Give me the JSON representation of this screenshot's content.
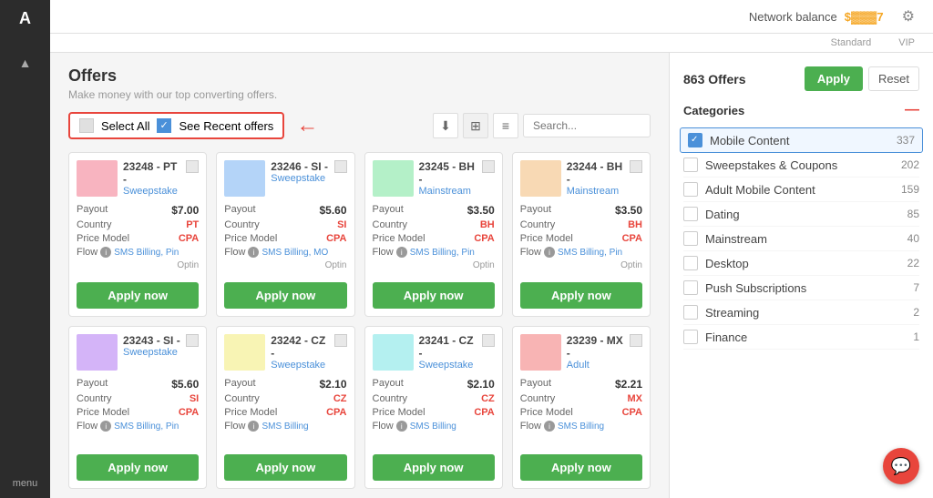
{
  "sidebar": {
    "logo": "A",
    "arrow": "▲",
    "menu_label": "menu"
  },
  "header": {
    "network_balance_label": "Network balance",
    "balance_amount": "$▓▓▓7",
    "standard_label": "Standard",
    "vip_label": "VIP",
    "gear_icon": "⚙"
  },
  "toolbar": {
    "select_all_label": "Select All",
    "see_recent_label": "See Recent offers",
    "search_placeholder": "Search...",
    "download_icon": "⬇",
    "grid_icon": "⊞",
    "list_icon": "≡"
  },
  "page": {
    "title": "Offers",
    "subtitle": "Make money with our top converting offers."
  },
  "filter_panel": {
    "offers_count": "863 Offers",
    "apply_btn": "Apply",
    "reset_btn": "Reset",
    "categories_title": "Categories",
    "categories": [
      {
        "name": "Mobile Content",
        "count": 337,
        "checked": true
      },
      {
        "name": "Sweepstakes & Coupons",
        "count": 202,
        "checked": false
      },
      {
        "name": "Adult Mobile Content",
        "count": 159,
        "checked": false
      },
      {
        "name": "Dating",
        "count": 85,
        "checked": false
      },
      {
        "name": "Mainstream",
        "count": 40,
        "checked": false
      },
      {
        "name": "Desktop",
        "count": 22,
        "checked": false
      },
      {
        "name": "Push Subscriptions",
        "count": 7,
        "checked": false
      },
      {
        "name": "Streaming",
        "count": 2,
        "checked": false
      },
      {
        "name": "Finance",
        "count": 1,
        "checked": false
      }
    ]
  },
  "offers": [
    {
      "id": "23248 - PT -",
      "type": "Sweepstake",
      "payout": "$7.00",
      "country": "PT",
      "price_model": "CPA",
      "flow": "SMS Billing, Pin",
      "optin": "Optin",
      "thumb_color": "pink"
    },
    {
      "id": "23246 - SI -",
      "type": "Sweepstake",
      "payout": "$5.60",
      "country": "SI",
      "price_model": "CPA",
      "flow": "SMS Billing, MO",
      "optin": "Optin",
      "thumb_color": "blue"
    },
    {
      "id": "23245 - BH -",
      "type": "Mainstream",
      "payout": "$3.50",
      "country": "BH",
      "price_model": "CPA",
      "flow": "SMS Billing, Pin",
      "optin": "Optin",
      "thumb_color": "green"
    },
    {
      "id": "23244 - BH -",
      "type": "Mainstream",
      "payout": "$3.50",
      "country": "BH",
      "price_model": "CPA",
      "flow": "SMS Billing, Pin",
      "optin": "Optin",
      "thumb_color": "orange"
    },
    {
      "id": "23243 - SI -",
      "type": "Sweepstake",
      "payout": "$5.60",
      "country": "SI",
      "price_model": "CPA",
      "flow": "SMS Billing, Pin",
      "optin": "",
      "thumb_color": "purple"
    },
    {
      "id": "23242 - CZ -",
      "type": "Sweepstake",
      "payout": "$2.10",
      "country": "CZ",
      "price_model": "CPA",
      "flow": "SMS Billing",
      "optin": "",
      "thumb_color": "yellow"
    },
    {
      "id": "23241 - CZ -",
      "type": "Sweepstake",
      "payout": "$2.10",
      "country": "CZ",
      "price_model": "CPA",
      "flow": "SMS Billing",
      "optin": "",
      "thumb_color": "teal"
    },
    {
      "id": "23239 - MX -",
      "type": "Adult",
      "payout": "$2.21",
      "country": "MX",
      "price_model": "CPA",
      "flow": "SMS Billing",
      "optin": "",
      "thumb_color": "red"
    }
  ],
  "labels": {
    "payout": "Payout",
    "country": "Country",
    "price_model": "Price Model",
    "flow": "Flow",
    "apply_now": "Apply now"
  },
  "chat_bubble_icon": "💬"
}
